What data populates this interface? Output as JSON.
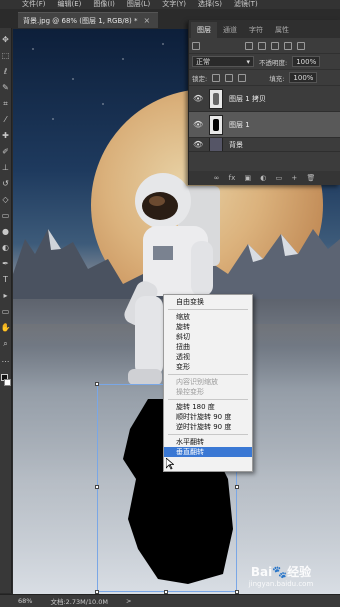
{
  "menu": [
    "文件(F)",
    "编辑(E)",
    "图像(I)",
    "图层(L)",
    "文字(Y)",
    "选择(S)",
    "滤镜(T)"
  ],
  "document_tab": {
    "title": "背景.jpg @ 68% (图层 1, RGB/8) *",
    "close": "×"
  },
  "toolbar": {
    "tools": [
      {
        "name": "move-tool",
        "glyph": "✥"
      },
      {
        "name": "marquee-tool",
        "glyph": "⬚"
      },
      {
        "name": "lasso-tool",
        "glyph": "ℓ"
      },
      {
        "name": "quick-select-tool",
        "glyph": "✎"
      },
      {
        "name": "crop-tool",
        "glyph": "⌗"
      },
      {
        "name": "eyedropper-tool",
        "glyph": "⁄"
      },
      {
        "name": "healing-tool",
        "glyph": "✚"
      },
      {
        "name": "brush-tool",
        "glyph": "✐"
      },
      {
        "name": "stamp-tool",
        "glyph": "⊥"
      },
      {
        "name": "history-brush-tool",
        "glyph": "↺"
      },
      {
        "name": "eraser-tool",
        "glyph": "◇"
      },
      {
        "name": "gradient-tool",
        "glyph": "▭"
      },
      {
        "name": "blur-tool",
        "glyph": "●"
      },
      {
        "name": "dodge-tool",
        "glyph": "◐"
      },
      {
        "name": "pen-tool",
        "glyph": "✒"
      },
      {
        "name": "type-tool",
        "glyph": "T"
      },
      {
        "name": "path-select-tool",
        "glyph": "▸"
      },
      {
        "name": "shape-tool",
        "glyph": "▭"
      },
      {
        "name": "hand-tool",
        "glyph": "✋"
      },
      {
        "name": "zoom-tool",
        "glyph": "⌕"
      },
      {
        "name": "more-tool",
        "glyph": "…"
      }
    ]
  },
  "layers_panel": {
    "tabs": [
      "图层",
      "通道",
      "字符",
      "属性"
    ],
    "blend_mode": "正常",
    "opacity_label": "不透明度:",
    "opacity_value": "100%",
    "lock_label": "锁定:",
    "fill_label": "填充:",
    "fill_value": "100%",
    "layers": [
      {
        "name": "图层 1 拷贝",
        "selected": false
      },
      {
        "name": "图层 1",
        "selected": true
      },
      {
        "name": "背景",
        "selected": false
      }
    ],
    "footer_icons": [
      "∞",
      "fx",
      "▣",
      "◐",
      "▭",
      "+",
      "🗑"
    ]
  },
  "context_menu": {
    "title": "自由变换",
    "groups": [
      [
        "缩放",
        "旋转",
        "斜切",
        "扭曲",
        "透视",
        "变形"
      ],
      [
        "内容识别缩放",
        "操控变形"
      ],
      [
        "旋转 180 度",
        "顺时针旋转 90 度",
        "逆时针旋转 90 度"
      ],
      [
        "水平翻转",
        "垂直翻转"
      ]
    ],
    "disabled": [
      "内容识别缩放",
      "操控变形"
    ],
    "highlighted": "垂直翻转"
  },
  "status_bar": {
    "zoom": "68%",
    "doc": "文档:2.73M/10.0M",
    "arrow": ">"
  },
  "watermark": {
    "line1": "Bai🐾经验",
    "line2": "jingyan.baidu.com"
  },
  "colors": {
    "accent": "#3a78d4",
    "panel_bg": "#3c3c3c",
    "menu_bg": "#f2f2f2"
  }
}
